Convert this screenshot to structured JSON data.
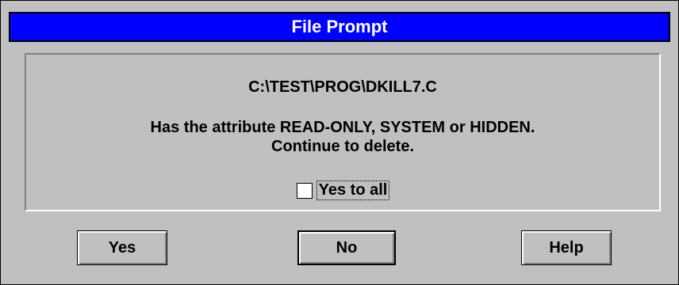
{
  "dialog": {
    "title": "File Prompt",
    "file_path": "C:\\TEST\\PROG\\DKILL7.C",
    "message_line1": "Has the attribute READ-ONLY, SYSTEM or HIDDEN.",
    "message_line2": "Continue to delete.",
    "checkbox_label": "Yes to all",
    "checkbox_checked": false,
    "buttons": {
      "yes": "Yes",
      "no": "No",
      "help": "Help"
    }
  },
  "colors": {
    "titlebar": "#0000ff",
    "background": "#c0c0c0"
  }
}
